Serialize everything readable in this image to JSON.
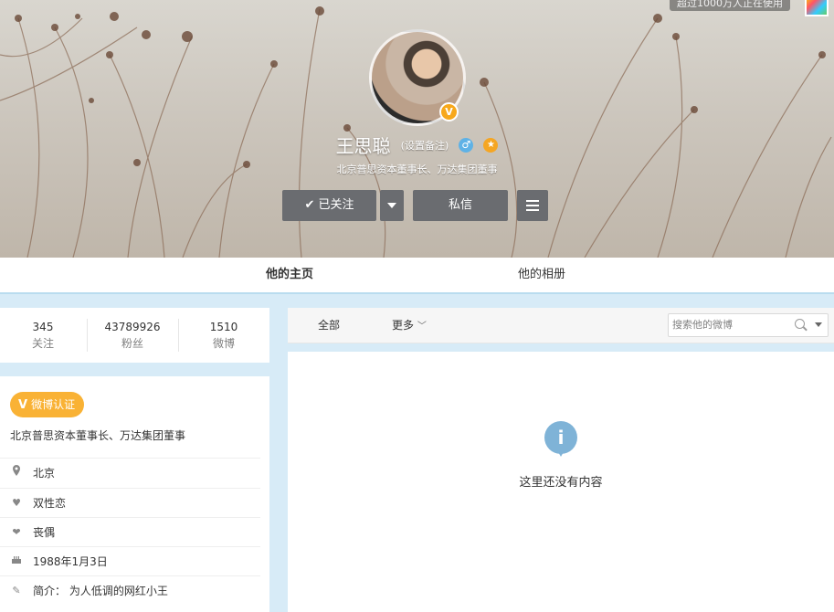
{
  "top_badge": "超过1000万人正在使用",
  "profile": {
    "name": "王思聪",
    "remark": "(设置备注)",
    "bio": "北京普思资本董事长、万达集团董事",
    "verified_badge": "V"
  },
  "actions": {
    "follow_label": "已关注",
    "message_label": "私信"
  },
  "tabs": [
    {
      "label": "他的主页"
    },
    {
      "label": "他的相册"
    }
  ],
  "stats": [
    {
      "value": "345",
      "label": "关注"
    },
    {
      "value": "43789926",
      "label": "粉丝"
    },
    {
      "value": "1510",
      "label": "微博"
    }
  ],
  "info": {
    "cert_icon": "V",
    "cert_label": "微博认证",
    "cert_desc": "北京普思资本董事长、万达集团董事",
    "rows": [
      {
        "icon": "location-icon",
        "text": "北京"
      },
      {
        "icon": "heart-icon",
        "text": "双性恋"
      },
      {
        "icon": "hearts-icon",
        "text": "丧偶"
      },
      {
        "icon": "cake-icon",
        "text": "1988年1月3日"
      },
      {
        "icon": "edit-icon",
        "text": "简介： 为人低调的网红小王"
      }
    ]
  },
  "feed": {
    "filter_all": "全部",
    "filter_more": "更多",
    "search_placeholder": "搜索他的微博",
    "empty_text": "这里还没有内容"
  }
}
